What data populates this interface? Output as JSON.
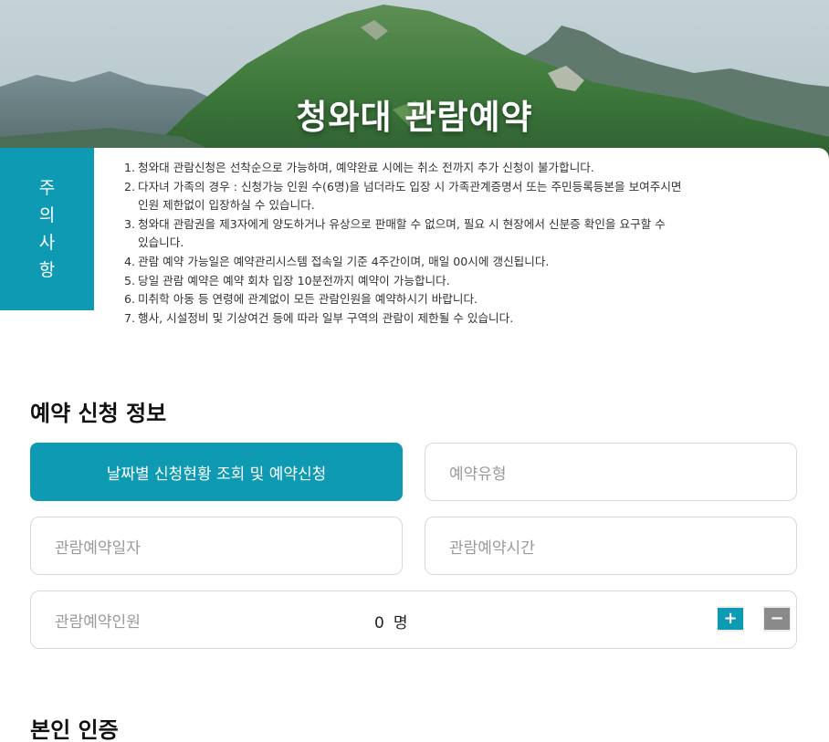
{
  "hero": {
    "title": "청와대 관람예약"
  },
  "notice": {
    "tab_chars": [
      "주",
      "의",
      "사",
      "항"
    ],
    "items": [
      {
        "num": "1.",
        "lines": [
          "청와대 관람신청은 선착순으로 가능하며, 예약완료 시에는 취소 전까지 추가 신청이 불가합니다."
        ]
      },
      {
        "num": "2.",
        "lines": [
          "다자녀 가족의 경우 : 신청가능 인원 수(6명)을 넘더라도 입장 시 가족관계증명서 또는 주민등록등본을 보여주시면",
          "인원 제한없이 입장하실 수 있습니다."
        ]
      },
      {
        "num": "3.",
        "lines": [
          "청와대 관람권을 제3자에게 양도하거나 유상으로 판매할 수 없으며, 필요 시 현장에서 신분증 확인을 요구할 수",
          "있습니다."
        ]
      },
      {
        "num": "4.",
        "lines": [
          "관람 예약 가능일은 예약관리시스템 접속일 기준 4주간이며, 매일 00시에 갱신됩니다."
        ]
      },
      {
        "num": "5.",
        "lines": [
          "당일 관람 예약은 예약 회차 입장 10분전까지 예약이 가능합니다."
        ]
      },
      {
        "num": "6.",
        "lines": [
          "미취학 아동 등 연령에 관계없이 모든 관람인원을 예약하시기 바랍니다."
        ]
      },
      {
        "num": "7.",
        "lines": [
          "행사, 시설정비 및 기상여건 등에 따라 일부 구역의 관람이 제한될 수 있습니다."
        ]
      }
    ]
  },
  "reservation": {
    "section_title": "예약 신청 정보",
    "date_status_button": "날짜별 신청현황 조회 및 예약신청",
    "type_placeholder": "예약유형",
    "date_placeholder": "관람예약일자",
    "time_placeholder": "관람예약시간",
    "people_label": "관람예약인원",
    "people_count": "0",
    "people_unit": "명",
    "plus_label": "+",
    "minus_label": "−"
  },
  "auth": {
    "section_title": "본인 인증"
  },
  "colors": {
    "accent": "#0e9ab3",
    "minus_button": "#8a8a8a"
  }
}
